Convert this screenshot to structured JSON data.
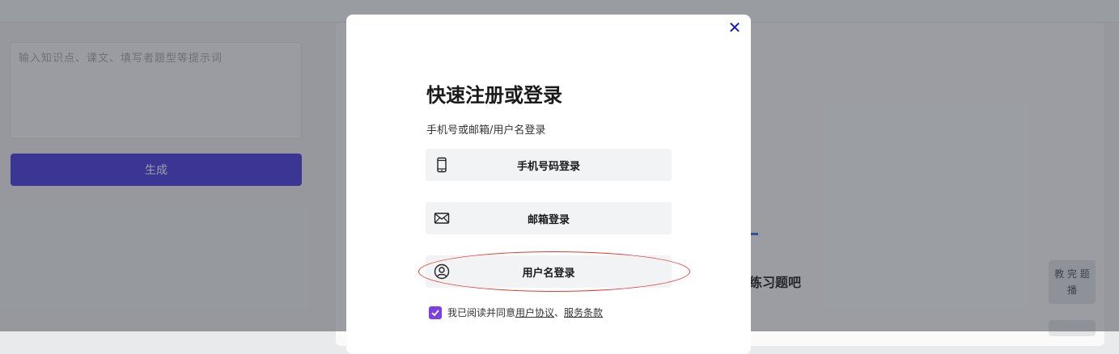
{
  "background": {
    "textarea_placeholder": "输入知识点、课文、填写者题型等提示词",
    "generate_label": "生成",
    "right_heading": "练习题吧",
    "side_button_label": "教 完 题 播"
  },
  "modal": {
    "close_symbol": "✕",
    "title": "快速注册或登录",
    "subtitle": "手机号或邮箱/用户名登录",
    "options": [
      {
        "label": "手机号码登录",
        "icon": "phone-icon"
      },
      {
        "label": "邮箱登录",
        "icon": "mail-icon"
      },
      {
        "label": "用户名登录",
        "icon": "user-icon"
      }
    ],
    "agreement": {
      "checked": true,
      "prefix": "我已阅读并同意",
      "user_agreement": "用户协议",
      "separator": "、",
      "service_terms": "服务条款"
    }
  },
  "colors": {
    "accent_purple": "#7b3fe4",
    "generate_button": "#4c3ee0",
    "close_blue": "#1717c9",
    "highlight_red": "#e53935"
  }
}
